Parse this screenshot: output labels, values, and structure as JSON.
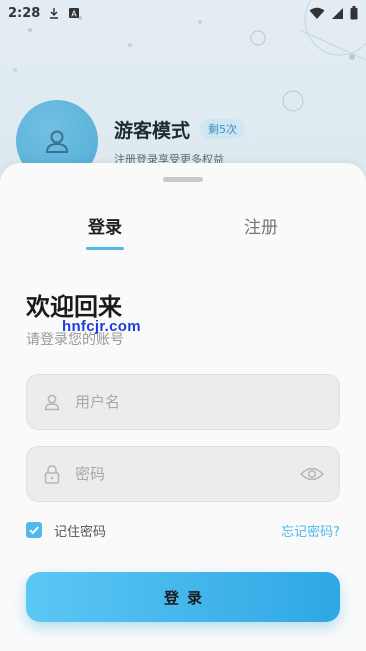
{
  "status_bar": {
    "time": "2:28",
    "icons": [
      "download-icon",
      "a-box-icon",
      "wifi-icon",
      "signal-icon",
      "battery-icon"
    ]
  },
  "background": {
    "guest_title": "游客模式",
    "guest_badge": "剩5次",
    "guest_subtitle": "注册登录享受更多权益"
  },
  "sheet": {
    "tabs": [
      {
        "label": "登录",
        "active": true
      },
      {
        "label": "注册",
        "active": false
      }
    ],
    "welcome": "欢迎回来",
    "subtitle": "请登录您的账号",
    "watermark": "hnfcjr.com",
    "username": {
      "placeholder": "用户名",
      "value": "",
      "icon": "user-icon"
    },
    "password": {
      "placeholder": "密码",
      "value": "",
      "icon": "lock-icon",
      "toggle_icon": "eye-icon"
    },
    "remember": {
      "label": "记住密码",
      "checked": true
    },
    "forgot_label": "忘记密码?",
    "login_button": "登录"
  },
  "colors": {
    "accent": "#4fb9ea",
    "button_gradient_start": "#5cc7f5",
    "button_gradient_end": "#2fa7e4"
  }
}
